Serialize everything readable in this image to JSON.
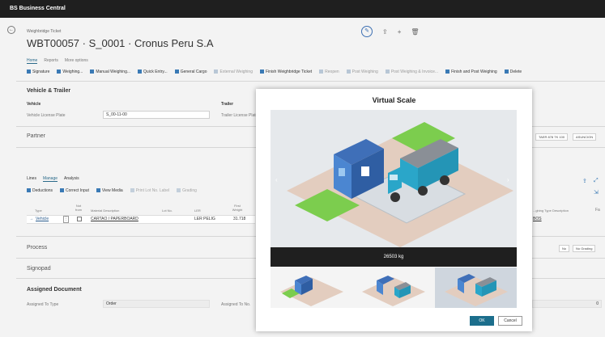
{
  "app": {
    "title": "BS Business Central"
  },
  "page": {
    "breadcrumb": "Weighbridge Ticket",
    "title": "WBT00057 · S_0001 · Cronus Peru S.A",
    "actions": {
      "edit": "✎",
      "share": "⇪",
      "new": "+",
      "delete": "🗑"
    },
    "tabs": [
      "Home",
      "Reports",
      "More options"
    ],
    "action_items": [
      {
        "label": "Signature",
        "dim": false
      },
      {
        "label": "Weighing...",
        "dim": false
      },
      {
        "label": "Manual Weighing...",
        "dim": false
      },
      {
        "label": "Quick Entry...",
        "dim": false
      },
      {
        "label": "General Cargo",
        "dim": false
      },
      {
        "label": "External Weighing",
        "dim": true
      },
      {
        "label": "Finish Weighbridge Ticket",
        "dim": false
      },
      {
        "label": "Reopen",
        "dim": true
      },
      {
        "label": "Post Weighing",
        "dim": true
      },
      {
        "label": "Post Weighing & Invoice...",
        "dim": true
      },
      {
        "label": "Finish and Post Weighing",
        "dim": false
      },
      {
        "label": "Delete",
        "dim": false
      }
    ]
  },
  "vehicle": {
    "section": "Vehicle & Trailer",
    "vehicle_label": "Vehicle",
    "plate_label": "Vehicle License Plate",
    "plate_value": "S_00-11-00",
    "trailer_label": "Trailer",
    "trailer_plate_label": "Trailer License Plate"
  },
  "partner": {
    "section": "Partner",
    "badges": [
      "TAER 878 TK 100",
      "ASUNCION"
    ]
  },
  "lines": {
    "tabs": [
      "Lines",
      "Manage",
      "Analysis"
    ],
    "actions": [
      {
        "label": "Deductions",
        "dim": false
      },
      {
        "label": "Correct Input",
        "dim": false
      },
      {
        "label": "View Media",
        "dim": false
      },
      {
        "label": "Print Lot No. Label",
        "dim": true
      },
      {
        "label": "Grading",
        "dim": true
      }
    ],
    "headers": {
      "type": "Type",
      "not_from": "Not from",
      "material": "Material Description",
      "lot": "Lot No.",
      "ler": "LER",
      "first_weight": "First Weight",
      "weighing_type": "...ghing Type Description"
    },
    "row": {
      "type": "Vehicle",
      "material": "CARTAO / PAPERBOARD",
      "ler": "LER PELIG",
      "first_weight": "31.718",
      "weighing_type": "BOS"
    }
  },
  "process": {
    "section": "Process",
    "badges": [
      "No",
      "No Grading"
    ]
  },
  "signopad": {
    "section": "Signopad"
  },
  "assigned": {
    "section": "Assigned Document",
    "type_label": "Assigned To Type",
    "type_value": "Order",
    "no_label": "Assigned To No.",
    "right_value": "0"
  },
  "dialog": {
    "title": "Virtual Scale",
    "weight": "26503 kg",
    "ok": "OK",
    "cancel": "Cancel",
    "prev": "‹",
    "next": "›"
  },
  "colors": {
    "accent": "#1c6e8c",
    "appbar": "#1f1f1f",
    "grass": "#7ccd4e",
    "truck": "#2aa6c9"
  }
}
